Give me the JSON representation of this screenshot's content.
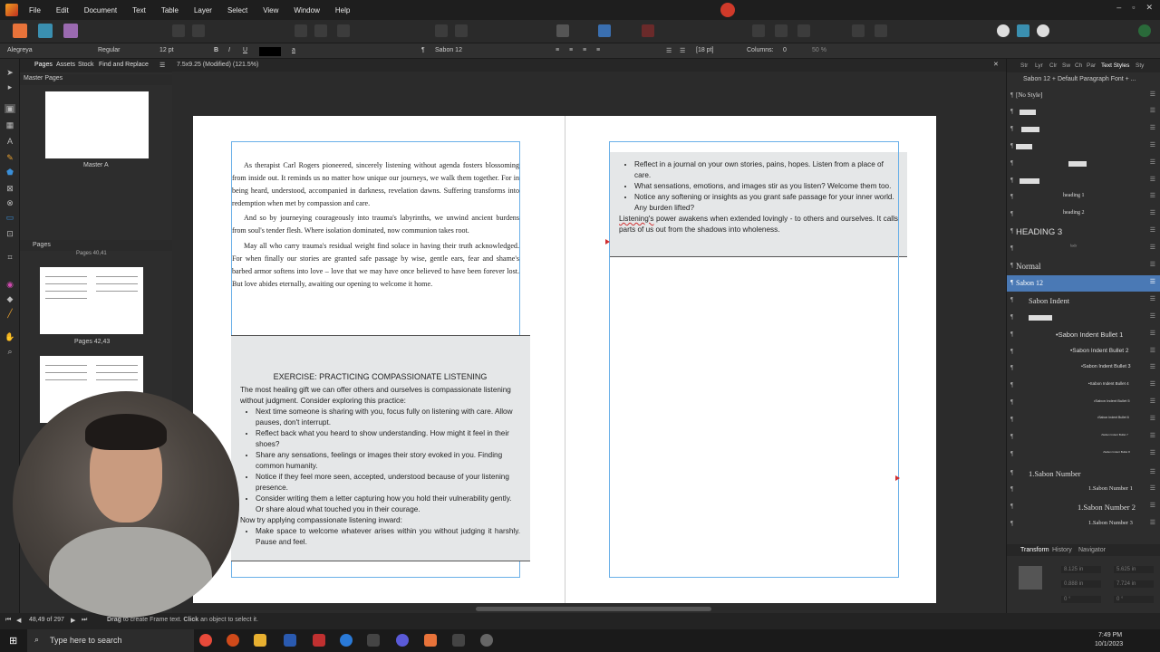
{
  "menubar": {
    "items": [
      "File",
      "Edit",
      "Document",
      "Text",
      "Table",
      "Layer",
      "Select",
      "View",
      "Window",
      "Help"
    ]
  },
  "context": {
    "font": "Alegreya",
    "weight": "Regular",
    "size": "12 pt",
    "char_style": "Sabon 12",
    "leading": "[18 pt]",
    "columns_label": "Columns:",
    "columns_value": "0",
    "zoom_value": "50 %"
  },
  "left_panel": {
    "tabs": [
      "Pages",
      "Assets",
      "Stock",
      "Find and Replace"
    ],
    "master_pages_title": "Master Pages",
    "master_a": "Master A",
    "pages_title": "Pages",
    "pages_label_top": "Pages 40,41",
    "pages_label_mid": "Pages 42,43"
  },
  "document": {
    "title": "7.5x9.25 (Modified) (121.5%)"
  },
  "page_left": {
    "paragraphs": [
      "As therapist Carl Rogers pioneered, sincerely listening without agenda fosters blossoming from inside out. It reminds us no matter how unique our journeys, we walk them together. For in being heard, understood, accompanied in darkness, revelation dawns. Suffering transforms into redemption when met by compassion and care.",
      "And so by journeying courageously into trauma's labyrinths, we unwind ancient burdens from soul's tender flesh. Where isolation dominated, now communion takes root.",
      "May all who carry trauma's residual weight find solace in having their truth acknowledged. For when finally our stories are granted safe passage by wise, gentle ears, fear and shame's barbed armor softens into love – love that we may have once believed to have been forever lost. But love abides eternally, awaiting our opening to welcome it home."
    ],
    "exercise_title": "EXERCISE: PRACTICING COMPASSIONATE LISTENING",
    "exercise_intro": "The most healing gift we can offer others and ourselves is compassionate listening without judgment. Consider exploring this practice:",
    "bullets": [
      "Next time someone is sharing with you, focus fully on listening with care. Allow pauses, don't interrupt.",
      "Reflect back what you heard to show understanding. How might it feel in their shoes?",
      "Share any sensations, feelings or images their story evoked in you. Finding common humanity.",
      "Notice if they feel more seen, accepted, understood because of your listening presence.",
      "Consider writing them a letter capturing how you hold their vulnerability gently. Or share aloud what touched you in their courage."
    ],
    "inward_intro": "Now try applying compassionate listening inward:",
    "inward_bullets": [
      "Make space to welcome whatever arises within you without judging it harshly. Pause and feel."
    ]
  },
  "page_right": {
    "bullets": [
      "Reflect in a journal on your own stories, pains, hopes. Listen from a place of care.",
      "What sensations, emotions, and images stir as you listen? Welcome them too.",
      "Notice any softening or insights as you grant safe passage for your inner world. Any burden lifted?"
    ],
    "closing_word": "Listening's",
    "closing_rest": " power awakens when extended lovingly - to others and ourselves. It calls parts of us out from the shadows into wholeness."
  },
  "right_panel": {
    "tabs": [
      "Str",
      "Lyr",
      "Clr",
      "Sw",
      "Ch",
      "Par",
      "Text Styles",
      "Sty"
    ],
    "header": "Sabon 12 + Default Paragraph Font + ...",
    "styles": [
      "[No Style]",
      "heading 1",
      "heading 2",
      "HEADING 3",
      "Normal",
      "Sabon 12",
      "Sabon Indent",
      "•Sabon Indent Bullet 1",
      "•Sabon Indent Bullet 2",
      "•Sabon Indent Bullet 3",
      "•Sabon Indent Bullet 4",
      "•Sabon Indent Bullet 5",
      "•Sabon Indent Bullet 6",
      "•Sabon Indent Bullet 7",
      "•Sabon Indent Bullet 8",
      "1.Sabon Number",
      "1.Sabon Number 1",
      "1.Sabon Number 2",
      "1.Sabon Number 3"
    ],
    "bottom_tabs": [
      "Transform",
      "History",
      "Navigator"
    ],
    "transform": {
      "x": "8.125 in",
      "y": "5.625 in",
      "w": "0.888 in",
      "h": "7.724 in",
      "r": "0 °",
      "s": "0 °"
    }
  },
  "status": {
    "page_counter": "48,49 of 297",
    "hint_drag": "Drag",
    "hint_mid": " to create Frame text. ",
    "hint_click": "Click",
    "hint_end": " an object to select it."
  },
  "taskbar": {
    "search_placeholder": "Type here to search",
    "time": "7:49 PM",
    "date": "10/1/2023"
  }
}
